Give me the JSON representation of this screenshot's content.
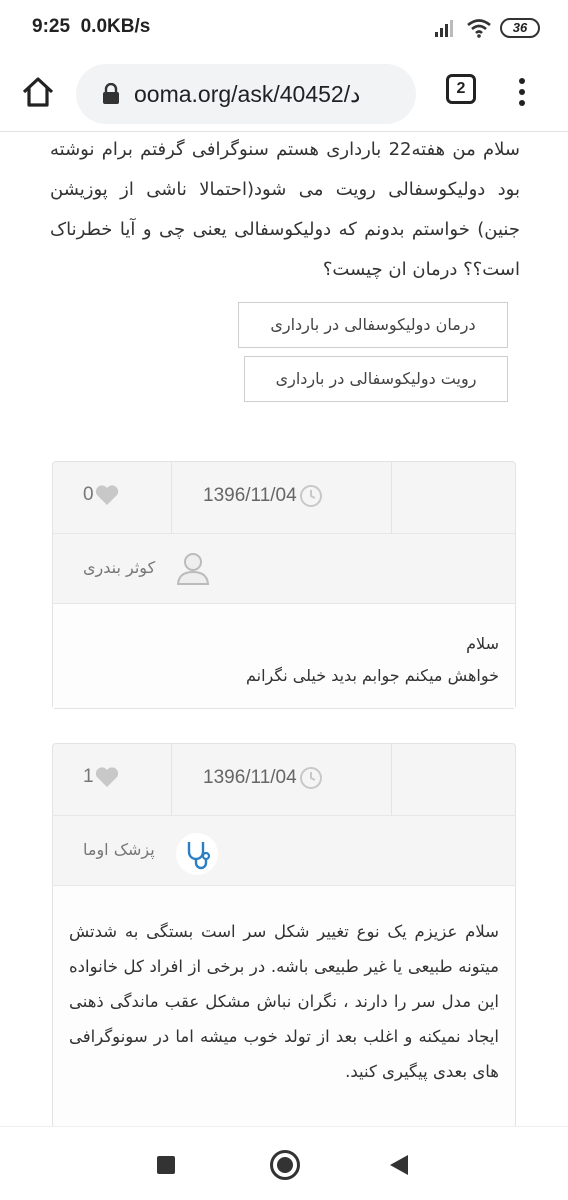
{
  "status_bar": {
    "time": "9:25",
    "network_speed": "0.0KB/s",
    "battery": "36"
  },
  "browser": {
    "url": "ooma.org/ask/40452/د",
    "tab_count": "2"
  },
  "question": {
    "text": "سلام من هفته22 بارداری هستم سنوگرافی گرفتم برام نوشته بود دولیکوسفالی رویت می شود(احتمالا ناشی از پوزیشن جنین) خواستم بدونم که دولیکوسفالی یعنی چی و آیا خطرناک است؟؟ درمان ان چیست؟",
    "tags": [
      "درمان دولیکوسفالی در بارداری",
      "رویت دولیکوسفالی در بارداری"
    ]
  },
  "answers": [
    {
      "likes": "0",
      "date": "1396/11/04",
      "author": "کوثر بندری",
      "body_lines": [
        "سلام",
        "خواهش میکنم جوابم بدید خیلی نگرانم"
      ]
    },
    {
      "likes": "1",
      "date": "1396/11/04",
      "author": "پزشک اوما",
      "body": "سلام عزیزم یک نوع تغییر شکل سر است بستگی به شدتش میتونه طبیعی یا غیر طبیعی باشه. در برخی از افراد کل خانواده این مدل سر را دارند ، نگران نباش مشکل عقب ماندگی ذهنی ایجاد نمیکنه و اغلب بعد از تولد خوب میشه اما در سونوگرافی های بعدی پیگیری کنید."
    }
  ],
  "colors": {
    "card_bg": "#f5f5f5",
    "avatar_accent": "#2a7fc4",
    "icon_gray": "#c8c8c8"
  }
}
